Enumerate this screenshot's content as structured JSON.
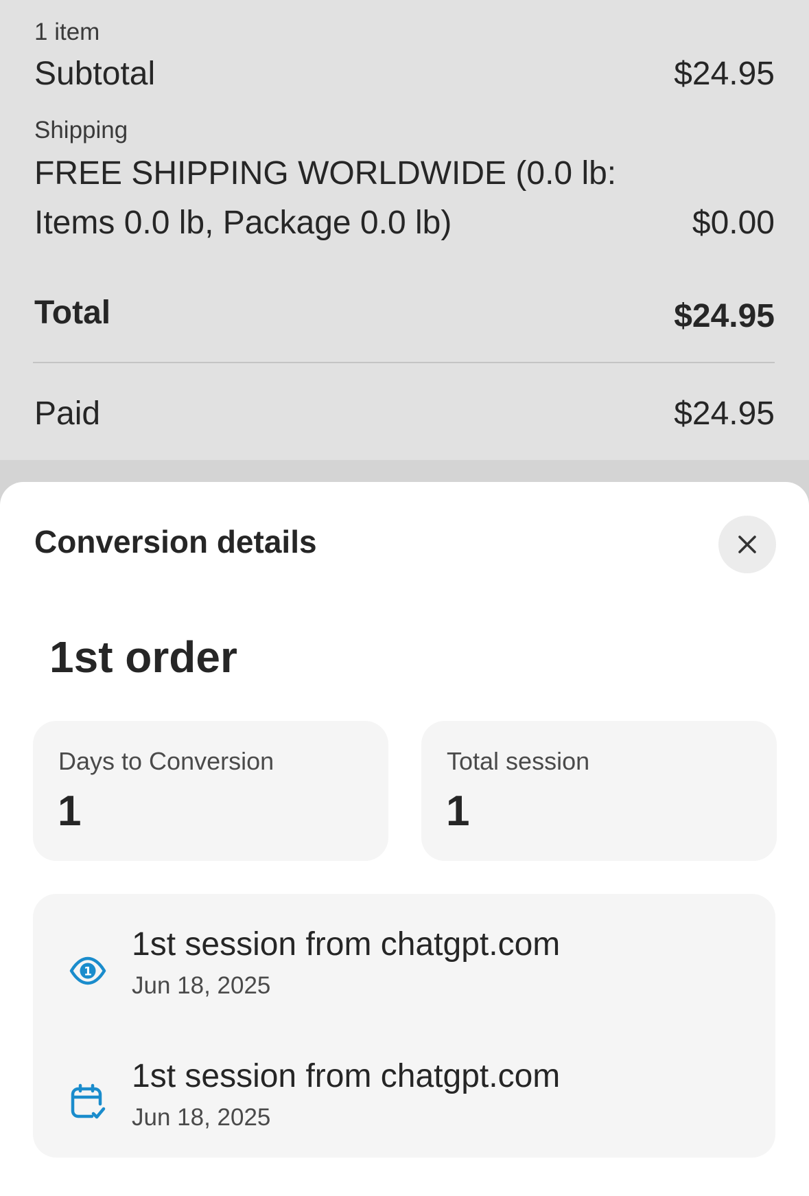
{
  "summary": {
    "items_count": "1 item",
    "subtotal_label": "Subtotal",
    "subtotal_value": "$24.95",
    "shipping_label": "Shipping",
    "shipping_method_line1": "FREE SHIPPING WORLDWIDE (0.0 lb:",
    "shipping_method_line2": "Items 0.0 lb, Package 0.0 lb)",
    "shipping_value": "$0.00",
    "total_label": "Total",
    "total_value": "$24.95",
    "paid_label": "Paid",
    "paid_value": "$24.95"
  },
  "sheet": {
    "title": "Conversion details",
    "close_icon": "close-icon",
    "order_heading": "1st order",
    "stats": [
      {
        "label": "Days to Conversion",
        "value": "1"
      },
      {
        "label": "Total session",
        "value": "1"
      }
    ],
    "sessions": [
      {
        "icon": "first-session-eye-icon",
        "title": "1st session from chatgpt.com",
        "date": "Jun 18, 2025"
      },
      {
        "icon": "calendar-check-icon",
        "title": "1st session from chatgpt.com",
        "date": "Jun 18, 2025"
      }
    ]
  },
  "colors": {
    "accent": "#1a8ccc",
    "overlay_background": "#e1e1e1",
    "card_background": "#f5f5f5"
  }
}
